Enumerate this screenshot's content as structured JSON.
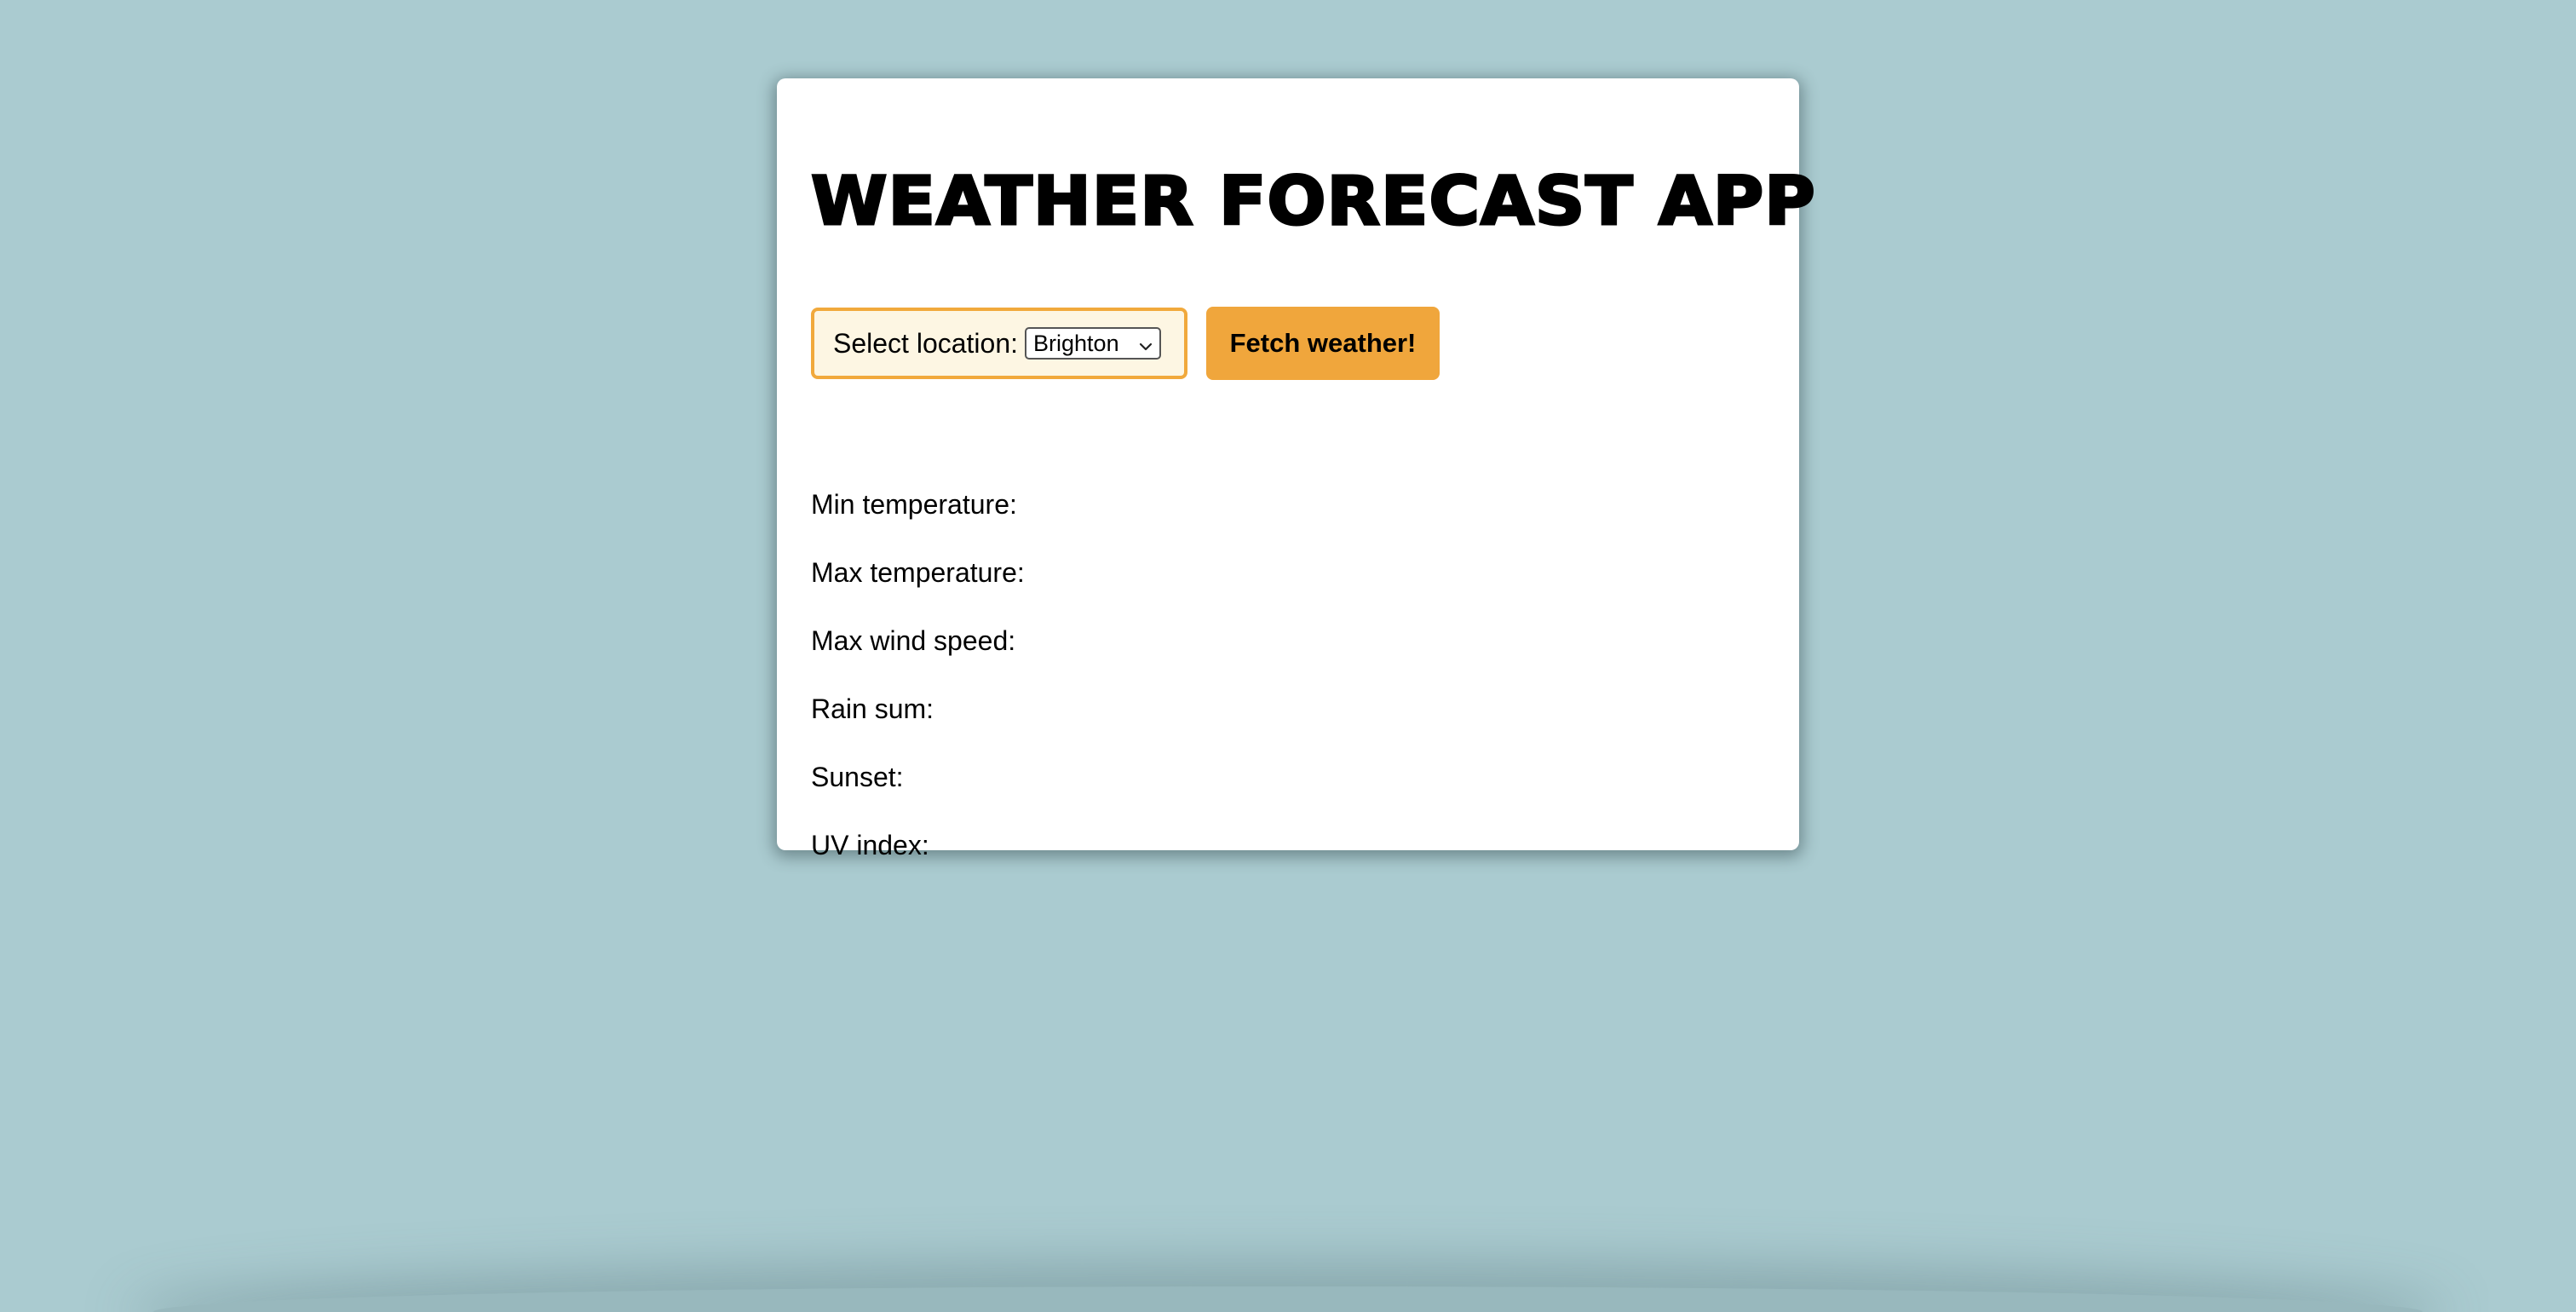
{
  "app": {
    "title": "WEATHER FORECAST APP"
  },
  "controls": {
    "location_label": "Select location:",
    "selected_location": "Brighton",
    "fetch_button_label": "Fetch weather!"
  },
  "stats": [
    {
      "label": "Min temperature:"
    },
    {
      "label": "Max temperature:"
    },
    {
      "label": "Max wind speed:"
    },
    {
      "label": "Rain sum:"
    },
    {
      "label": "Sunset:"
    },
    {
      "label": "UV index:"
    }
  ],
  "icons": {
    "select_arrow": "chevron-down-icon"
  },
  "colors": {
    "page_background": "#aacbd0",
    "card_background": "#ffffff",
    "accent": "#f0a63c",
    "location_box_background": "#fdf6e3"
  }
}
